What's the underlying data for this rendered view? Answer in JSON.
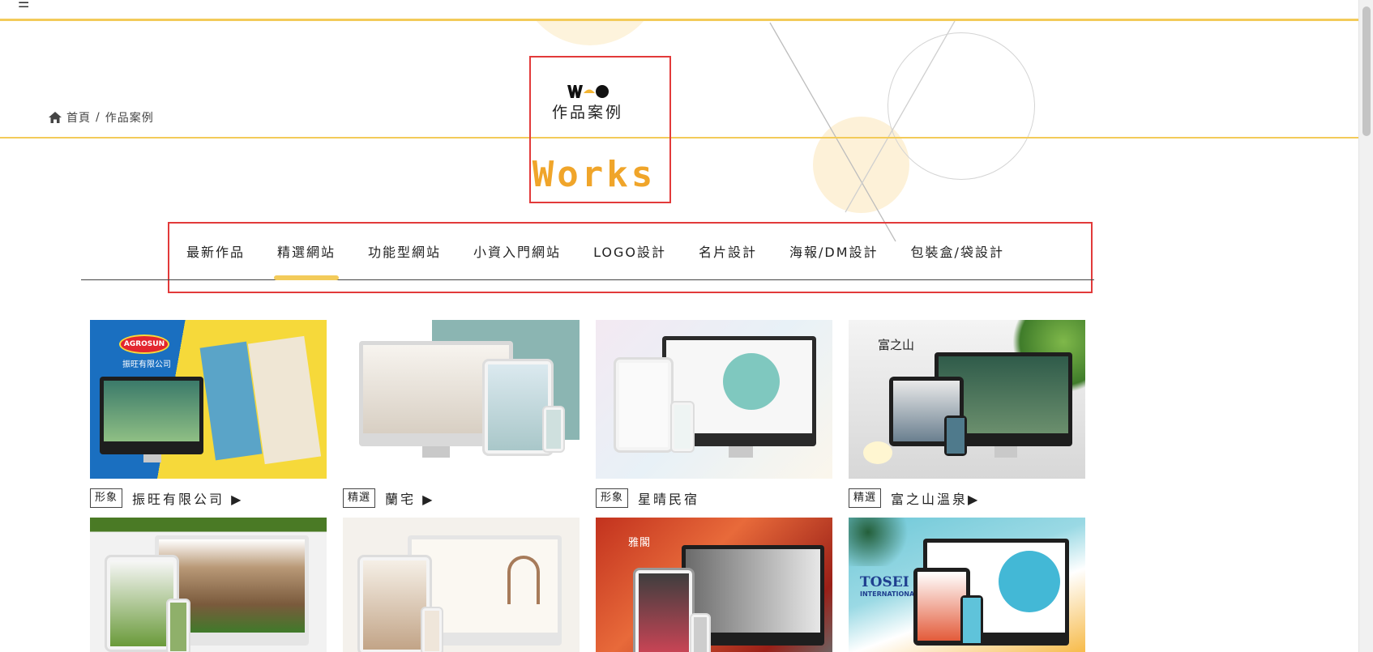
{
  "breadcrumb": {
    "home": "首頁",
    "separator": "/",
    "current": "作品案例"
  },
  "title": {
    "zh": "作品案例",
    "en": "Works"
  },
  "tabs": [
    {
      "label": "最新作品",
      "active": false
    },
    {
      "label": "精選網站",
      "active": true
    },
    {
      "label": "功能型網站",
      "active": false
    },
    {
      "label": "小資入門網站",
      "active": false
    },
    {
      "label": "LOGO設計",
      "active": false
    },
    {
      "label": "名片設計",
      "active": false
    },
    {
      "label": "海報/DM設計",
      "active": false
    },
    {
      "label": "包裝盒/袋設計",
      "active": false
    }
  ],
  "works": [
    {
      "badge": "形象",
      "title": "振旺有限公司 ▶"
    },
    {
      "badge": "精選",
      "title": "蘭宅 ▶"
    },
    {
      "badge": "形象",
      "title": "星晴民宿"
    },
    {
      "badge": "精選",
      "title": "富之山溫泉▶"
    }
  ],
  "thumb_labels": {
    "agrosun_brand": "AGROSUN",
    "agrosun_company": "振旺有限公司",
    "fuji_brand": "富之山",
    "tosei_brand": "TOSEI",
    "tosei_sub": "INTERNATIONAL",
    "maple_brand": "雅閣"
  },
  "colors": {
    "accent": "#f3cb5a",
    "works_orange": "#f0a52a",
    "highlight_red": "#e23a3a"
  }
}
